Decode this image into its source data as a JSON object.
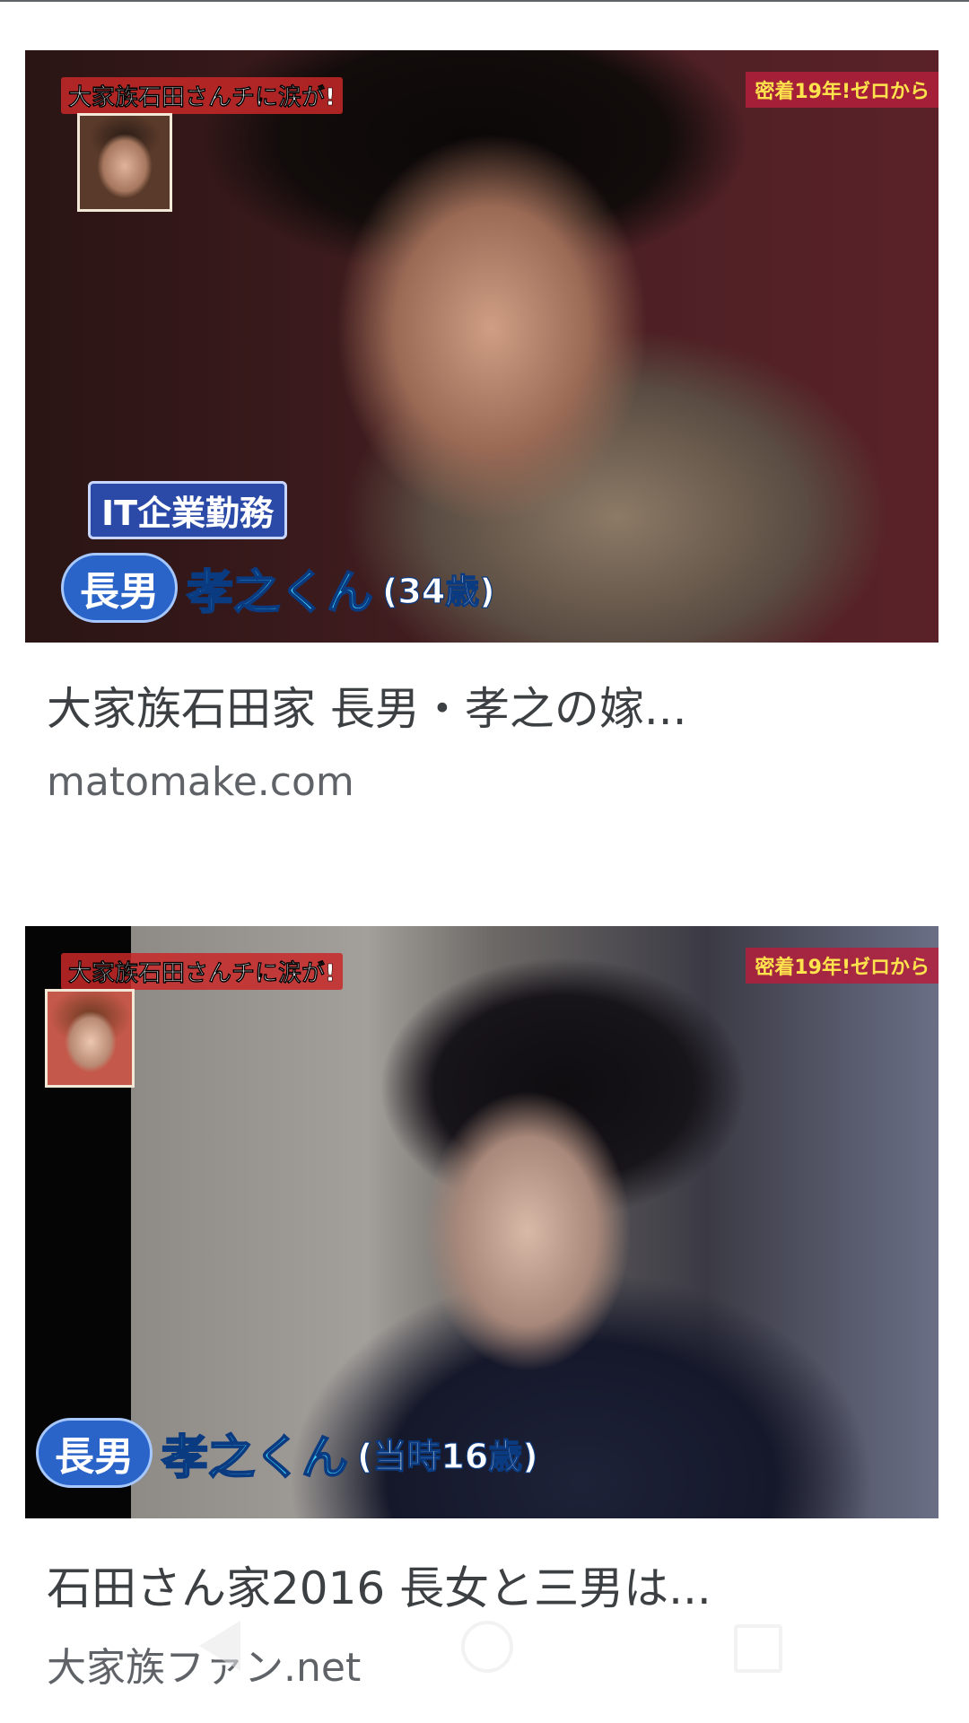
{
  "results": [
    {
      "overlay": {
        "banner_top": "大家族石田さんチに涙が!",
        "banner_right": "密着19年!ゼロから",
        "badge": "IT企業勤務",
        "pill": "長男",
        "name": "孝之くん",
        "age": "(34歳)"
      },
      "title": "大家族石田家 長男・孝之の嫁...",
      "source": "matomake.com"
    },
    {
      "overlay": {
        "banner_top": "大家族石田さんチに涙が!",
        "banner_right": "密着19年!ゼロから",
        "pill": "長男",
        "name": "孝之くん",
        "age": "(当時16歳)"
      },
      "title": "石田さん家2016 長女と三男は...",
      "source": "大家族ファン.net"
    }
  ],
  "colors": {
    "title": "#3c4043",
    "source": "#5f6368",
    "background": "#ffffff"
  }
}
